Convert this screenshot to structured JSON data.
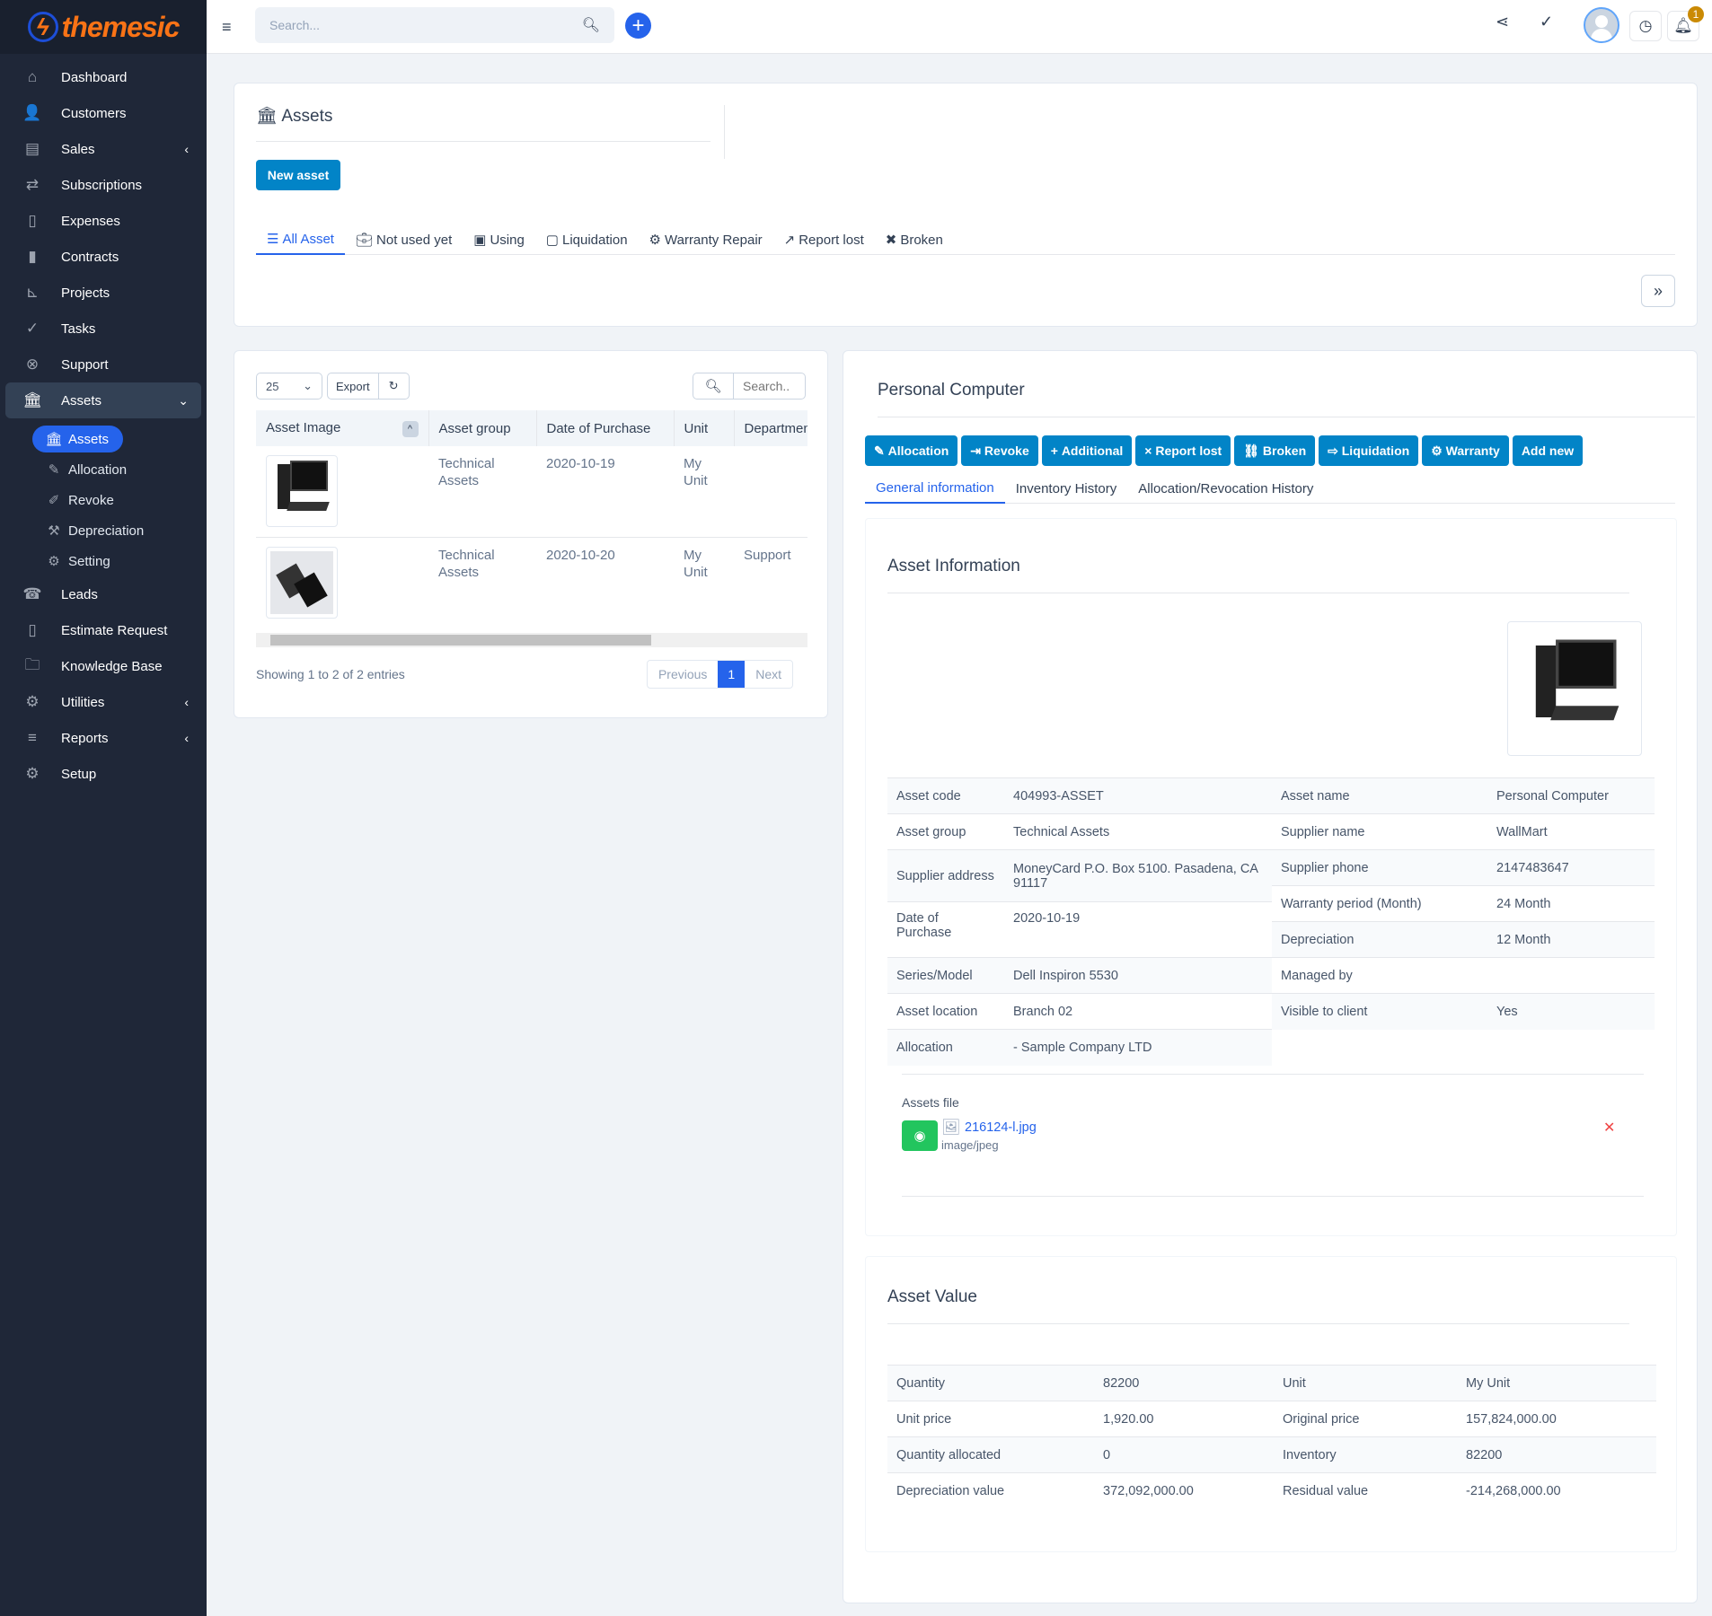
{
  "brand": {
    "name": "themesic",
    "accent": "#f97316"
  },
  "header": {
    "search_placeholder": "Search...",
    "notification_count": "1"
  },
  "sidebar": {
    "items": [
      {
        "label": "Dashboard",
        "icon": "home-icon"
      },
      {
        "label": "Customers",
        "icon": "user-icon"
      },
      {
        "label": "Sales",
        "icon": "receipt-icon"
      },
      {
        "label": "Subscriptions",
        "icon": "repeat-icon"
      },
      {
        "label": "Expenses",
        "icon": "file-text-icon"
      },
      {
        "label": "Contracts",
        "icon": "file-contract-icon"
      },
      {
        "label": "Projects",
        "icon": "chart-steps-icon"
      },
      {
        "label": "Tasks",
        "icon": "check-circle-icon"
      },
      {
        "label": "Support",
        "icon": "life-ring-icon"
      },
      {
        "label": "Assets",
        "icon": "bank-icon"
      },
      {
        "label": "Leads",
        "icon": "phone-icon"
      },
      {
        "label": "Estimate Request",
        "icon": "file-icon"
      },
      {
        "label": "Knowledge Base",
        "icon": "folder-icon"
      },
      {
        "label": "Utilities",
        "icon": "cogs-icon"
      },
      {
        "label": "Reports",
        "icon": "chart-icon"
      },
      {
        "label": "Setup",
        "icon": "gear-icon"
      }
    ],
    "sub_items": [
      {
        "label": "Assets"
      },
      {
        "label": "Allocation"
      },
      {
        "label": "Revoke"
      },
      {
        "label": "Depreciation"
      },
      {
        "label": "Setting"
      }
    ]
  },
  "page": {
    "title": "Assets",
    "new_button": "New asset",
    "tabs": [
      "All Asset",
      "Not used yet",
      "Using",
      "Liquidation",
      "Warranty Repair",
      "Report lost",
      "Broken"
    ]
  },
  "list": {
    "page_size": "25",
    "export": "Export",
    "search_placeholder": "Search..",
    "columns": [
      "Asset Image",
      "Asset group",
      "Date of Purchase",
      "Unit",
      "Departmen"
    ],
    "rows": [
      {
        "group": "Technical Assets",
        "date": "2020-10-19",
        "unit": "My Unit",
        "department": ""
      },
      {
        "group": "Technical Assets",
        "date": "2020-10-20",
        "unit": "My Unit",
        "department": "Support"
      }
    ],
    "info": "Showing 1 to 2 of 2 entries",
    "prev": "Previous",
    "page": "1",
    "next": "Next"
  },
  "detail": {
    "title": "Personal Computer",
    "actions": [
      "Allocation",
      "Revoke",
      "Additional",
      "Report lost",
      "Broken",
      "Liquidation",
      "Warranty",
      "Add new"
    ],
    "tabs": [
      "General information",
      "Inventory History",
      "Allocation/Revocation History"
    ],
    "info_title": "Asset Information",
    "left": [
      {
        "k": "Asset code",
        "v": "404993-ASSET"
      },
      {
        "k": "Asset group",
        "v": "Technical Assets"
      },
      {
        "k": "Supplier address",
        "v": "MoneyCard P.O. Box 5100. Pasadena, CA 91117"
      },
      {
        "k": "Date of Purchase",
        "v": "2020-10-19"
      },
      {
        "k": "Series/Model",
        "v": "Dell Inspiron 5530"
      },
      {
        "k": "Asset location",
        "v": "Branch 02"
      },
      {
        "k": "Allocation",
        "v": "- Sample Company LTD"
      }
    ],
    "right": [
      {
        "k": "Asset name",
        "v": "Personal Computer"
      },
      {
        "k": "Supplier name",
        "v": "WallMart"
      },
      {
        "k": "Supplier phone",
        "v": "2147483647"
      },
      {
        "k": "Warranty period (Month)",
        "v": "24 Month"
      },
      {
        "k": "Depreciation",
        "v": "12 Month"
      },
      {
        "k": "Managed by",
        "v": ""
      },
      {
        "k": "Visible to client",
        "v": "Yes"
      }
    ],
    "files_label": "Assets file",
    "file_name": "216124-l.jpg",
    "file_type": "image/jpeg",
    "value_title": "Asset Value",
    "values": [
      [
        "Quantity",
        "82200",
        "Unit",
        "My Unit"
      ],
      [
        "Unit price",
        "1,920.00",
        "Original price",
        "157,824,000.00"
      ],
      [
        "Quantity allocated",
        "0",
        "Inventory",
        "82200"
      ],
      [
        "Depreciation value",
        "372,092,000.00",
        "Residual value",
        "-214,268,000.00"
      ]
    ]
  }
}
